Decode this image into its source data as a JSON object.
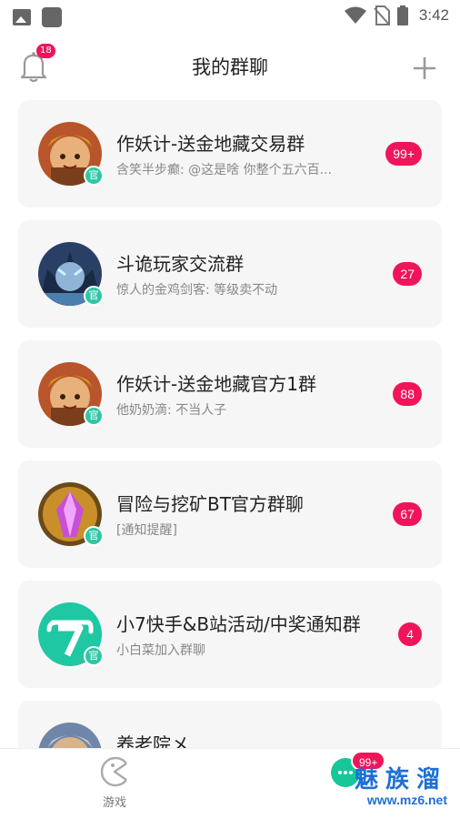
{
  "status_bar": {
    "time": "3:42",
    "icons": [
      "image-icon",
      "square-app-icon",
      "wifi-icon",
      "no-sim-icon",
      "battery-icon"
    ]
  },
  "header": {
    "title": "我的群聊",
    "bell_badge": "18"
  },
  "official_label": "官",
  "groups": [
    {
      "name": "作妖计-送金地藏交易群",
      "message": "含笑半步癫: @这是啥 你整个五六百...",
      "count": "99+",
      "official": true,
      "avatar": "warrior-avatar"
    },
    {
      "name": "斗诡玩家交流群",
      "message": "惊人的金鸡剑客: 等级卖不动",
      "count": "27",
      "official": true,
      "avatar": "dark-hero-avatar"
    },
    {
      "name": "作妖计-送金地藏官方1群",
      "message": "他奶奶滴: 不当人子",
      "count": "88",
      "official": true,
      "avatar": "warrior-avatar"
    },
    {
      "name": "冒险与挖矿BT官方群聊",
      "message": "[通知提醒]",
      "count": "67",
      "official": true,
      "avatar": "crystal-avatar"
    },
    {
      "name": "小7快手&B站活动/中奖通知群",
      "message": "小白菜加入群聊",
      "count": "4",
      "official": true,
      "avatar": "seven-logo-avatar"
    },
    {
      "name": "养老院メ",
      "message": "",
      "count": "",
      "official": false,
      "avatar": "warrior-avatar"
    }
  ],
  "tabbar": {
    "game_label": "游戏",
    "chat_badge": "99+"
  },
  "watermark": {
    "text": "魅族溜",
    "url": "www.mz6.net"
  },
  "colors": {
    "accent_badge": "#f0145a",
    "official_green": "#2fc6a4",
    "chat_green": "#16c79a",
    "card_bg": "#f6f6f6",
    "watermark_blue": "#1e6fd6"
  }
}
